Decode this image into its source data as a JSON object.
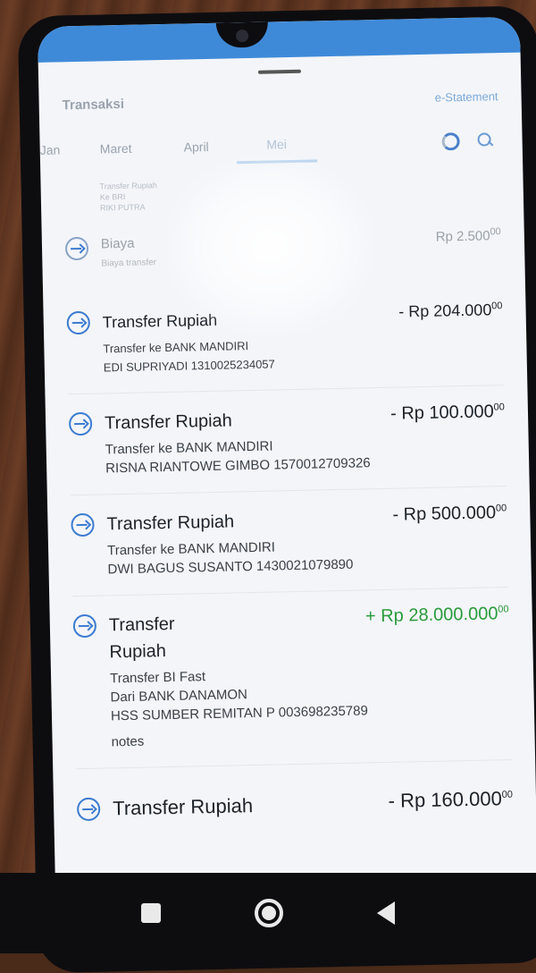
{
  "sheet": {
    "title": "Transaksi",
    "estatement": "e-Statement"
  },
  "tabs": [
    "Jan",
    "Maret",
    "April",
    "Mei"
  ],
  "faded_item": {
    "line1": "Transfer Rupiah",
    "line2": "Ke BRI",
    "line3": "RIKI PUTRA"
  },
  "rows": [
    {
      "name": "Biaya",
      "desc1": "Biaya transfer",
      "desc2": "",
      "desc3": "",
      "desc4": "",
      "amount": "Rp 2.500",
      "cents": "00",
      "type": "debit"
    },
    {
      "name": "Transfer Rupiah",
      "desc1": "Transfer ke BANK MANDIRI",
      "desc2": "EDI SUPRIYADI 1310025234057",
      "desc3": "",
      "desc4": "",
      "amount": "- Rp 204.000",
      "cents": "00",
      "type": "debit"
    },
    {
      "name": "Transfer Rupiah",
      "desc1": "Transfer ke BANK MANDIRI",
      "desc2": "RISNA RIANTOWE GIMBO 1570012709326",
      "desc3": "",
      "desc4": "",
      "amount": "- Rp 100.000",
      "cents": "00",
      "type": "debit"
    },
    {
      "name": "Transfer Rupiah",
      "desc1": "Transfer ke BANK MANDIRI",
      "desc2": "DWI BAGUS SUSANTO 1430021079890",
      "desc3": "",
      "desc4": "",
      "amount": "- Rp 500.000",
      "cents": "00",
      "type": "debit"
    },
    {
      "name": "Transfer Rupiah",
      "desc1": "Transfer BI Fast",
      "desc2": "Dari BANK DANAMON",
      "desc3": "HSS SUMBER REMITAN P 003698235789",
      "desc4": "notes",
      "amount": "+ Rp 28.000.000",
      "cents": "00",
      "type": "credit"
    },
    {
      "name": "Transfer Rupiah",
      "desc1": "",
      "desc2": "",
      "desc3": "",
      "desc4": "",
      "amount": "- Rp 160.000",
      "cents": "00",
      "type": "debit"
    }
  ],
  "colors": {
    "accent": "#3b7bd0",
    "credit": "#2a9b3b",
    "statusbar": "#3f8ad8"
  },
  "icons": {
    "row": "transfer-arrow-icon",
    "biaya": "fee-icon",
    "search": "search-icon",
    "sync": "refresh-icon"
  }
}
